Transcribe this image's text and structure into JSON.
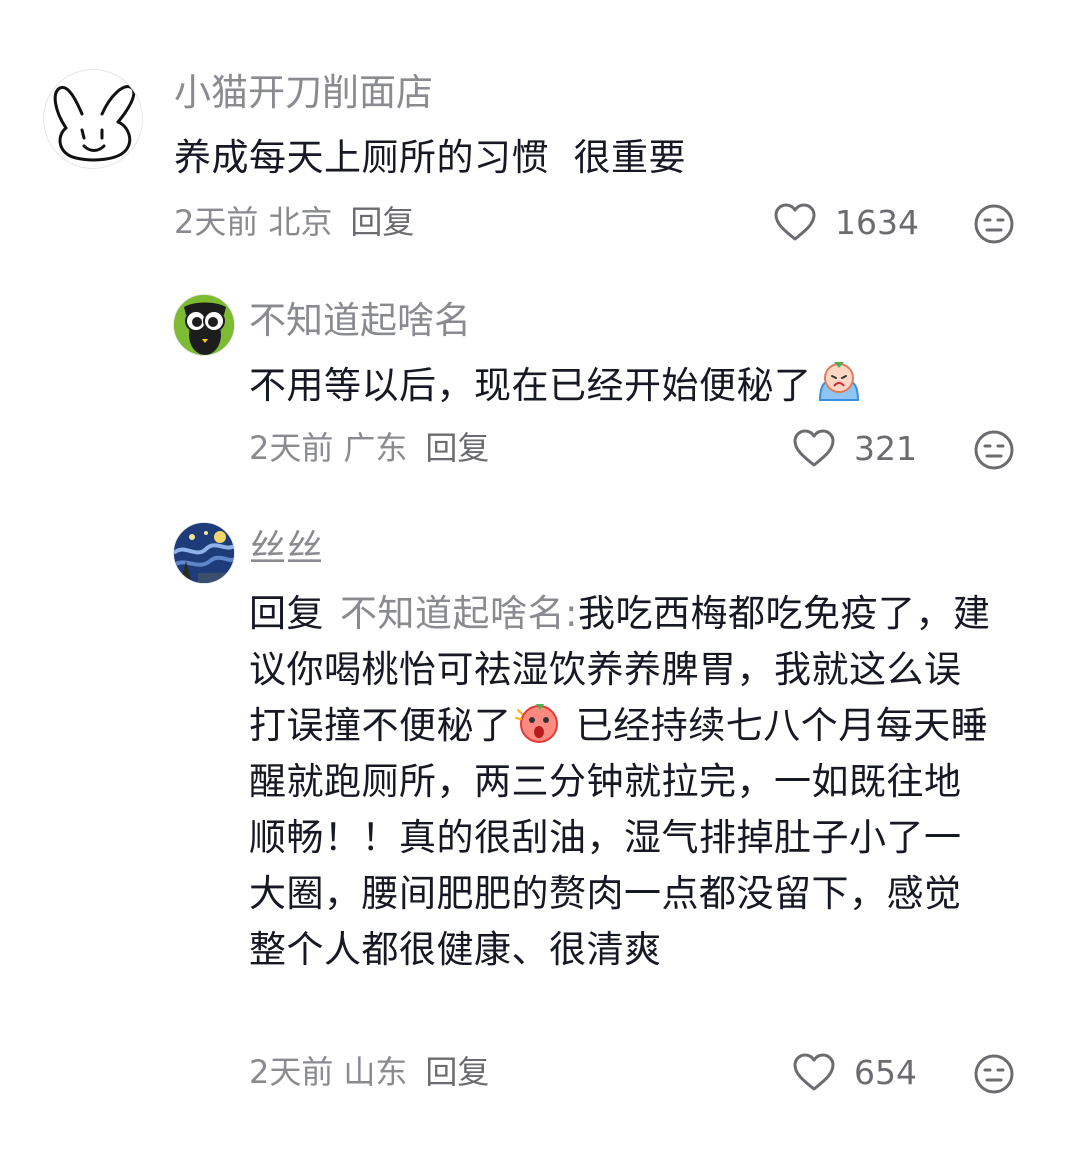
{
  "comments": [
    {
      "username": "小猫开刀削面店",
      "text": "养成每天上厕所的习惯  很重要",
      "time": "2天前",
      "location": "北京",
      "reply_label": "回复",
      "likes": "1634",
      "avatar_icon": "bunny-doodle-icon"
    },
    {
      "username": "不知道起啥名",
      "text": "不用等以后，现在已经开始便秘了",
      "emoji_icon": "crying-emoji-icon",
      "time": "2天前",
      "location": "广东",
      "reply_label": "回复",
      "likes": "321",
      "avatar_icon": "owl-cartoon-icon"
    },
    {
      "username": "丝丝",
      "reply_prefix": "回复",
      "reply_target": "不知道起啥名:",
      "text_part1": "我吃西梅都吃免疫了，建议你喝桃怡可祛湿饮养养脾胃，我就这么误打误撞不便秘了",
      "emoji_icon": "shocked-emoji-icon",
      "text_part2": " 已经持续七八个月每天睡醒就跑厕所，两三分钟就拉完，一如既往地顺畅！！真的很刮油，湿气排掉肚子小了一大圈，腰间肥肥的赘肉一点都没留下，感觉整个人都很健康、很清爽",
      "time": "2天前",
      "location": "山东",
      "reply_label": "回复",
      "likes": "654",
      "avatar_icon": "starry-night-icon"
    }
  ],
  "icons": {
    "like": "heart-outline-icon",
    "dislike": "meh-face-icon"
  },
  "colors": {
    "primary_text": "#161823",
    "secondary_text": "#8a8b91",
    "icon": "#6b6c72"
  }
}
